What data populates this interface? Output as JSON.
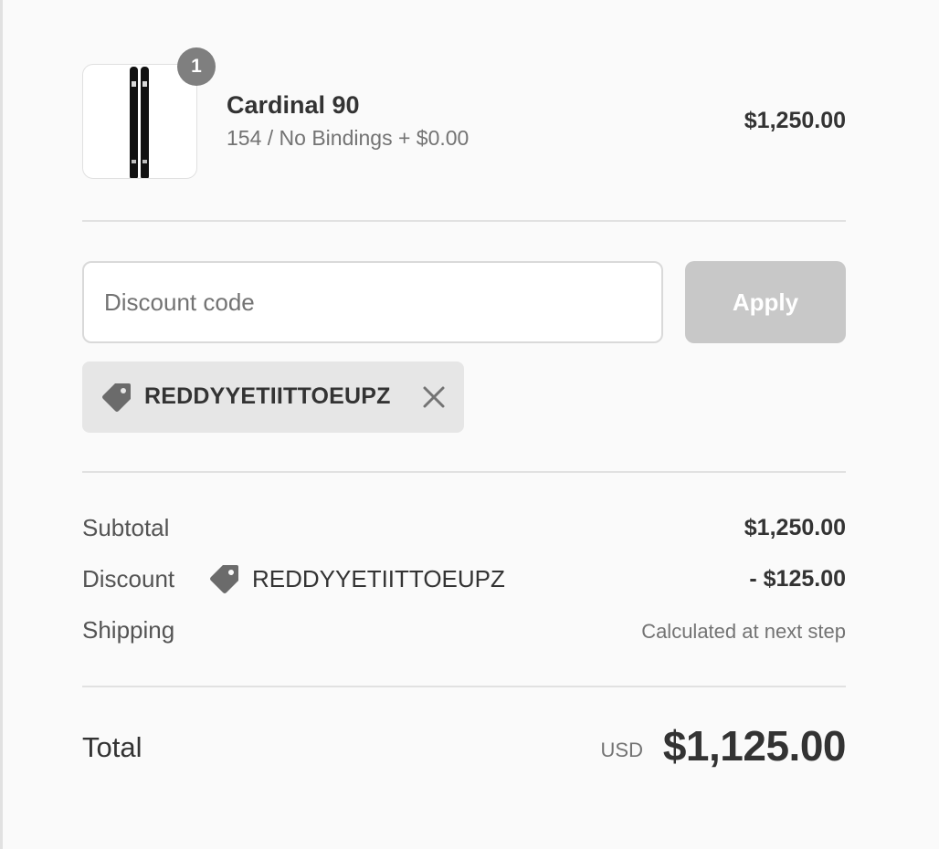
{
  "cart": {
    "items": [
      {
        "name": "Cardinal 90",
        "variant": "154 / No Bindings + $0.00",
        "price": "$1,250.00",
        "quantity": "1",
        "image_icon": "skis-image"
      }
    ]
  },
  "discount": {
    "placeholder": "Discount code",
    "value": "",
    "apply_label": "Apply",
    "applied_code": "REDDYYETIITTOEUPZ",
    "tag_icon": "tag-icon",
    "remove_icon": "close-icon"
  },
  "summary": {
    "subtotal_label": "Subtotal",
    "subtotal_value": "$1,250.00",
    "discount_label": "Discount",
    "discount_code": "REDDYYETIITTOEUPZ",
    "discount_value": "- $125.00",
    "shipping_label": "Shipping",
    "shipping_value": "Calculated at next step"
  },
  "total": {
    "label": "Total",
    "currency": "USD",
    "amount": "$1,125.00"
  },
  "colors": {
    "background": "#fafafa",
    "divider": "#e1e1e1",
    "badge": "#7f7f7f",
    "apply_disabled": "#c8c8c8",
    "tag_background": "#e6e6e6",
    "text_primary": "#333333",
    "text_secondary": "#737373"
  }
}
